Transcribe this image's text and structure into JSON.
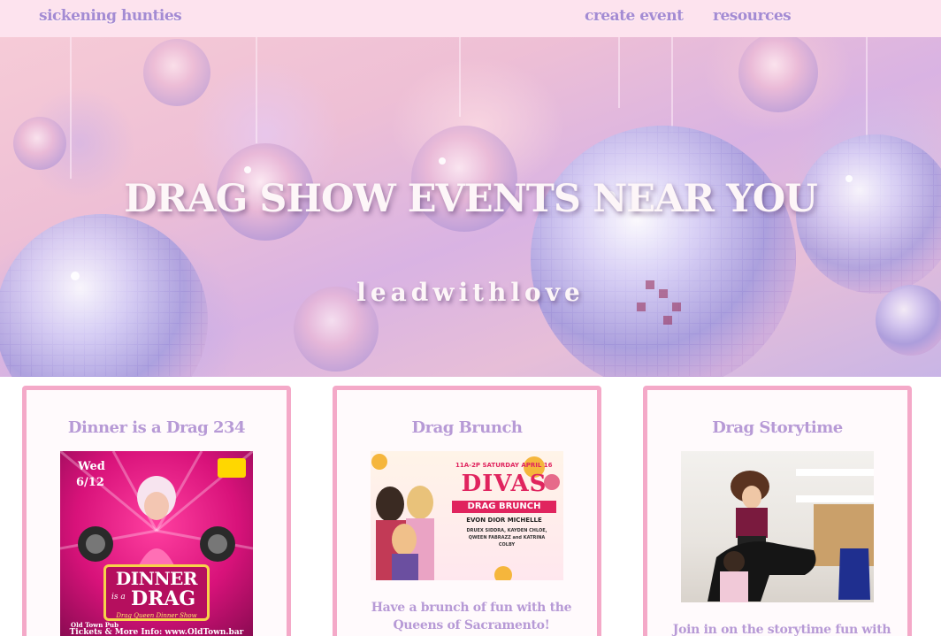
{
  "nav": {
    "brand": "sickening hunties",
    "links": [
      "create event",
      "resources"
    ]
  },
  "hero": {
    "title": "DRAG SHOW EVENTS NEAR YOU",
    "subtitle": "leadwithlove"
  },
  "events": [
    {
      "title": "Dinner is a Drag 234",
      "poster": {
        "date_day": "Wed",
        "date": "6/12",
        "word_top": "DINNER",
        "word_is": "is a",
        "word_bottom": "DRAG",
        "tagline": "Drag Queen Dinner Show",
        "venue": "Old Town Pub",
        "footer": "Tickets & More Info: www.OldTown.bar"
      },
      "description": ""
    },
    {
      "title": "Drag Brunch",
      "poster": {
        "time_line": "11A-2P SATURDAY APRIL 16",
        "divas": "DIVAS",
        "brunch": "DRAG BRUNCH",
        "host": "EVON DIOR MICHELLE",
        "guests": "DRUEX SIDDRA, KAYDEN CHLOE, QWEEN FABRAZZ and KATRINA COLBY"
      },
      "description": "Have a brunch of fun with the Queens of Sacramento!"
    },
    {
      "title": "Drag Storytime",
      "description": "Join in on the storytime fun with"
    }
  ],
  "colors": {
    "accent": "#a48bd3",
    "card_border": "#f4a9c8",
    "nav_bg": "#fde3ee"
  }
}
